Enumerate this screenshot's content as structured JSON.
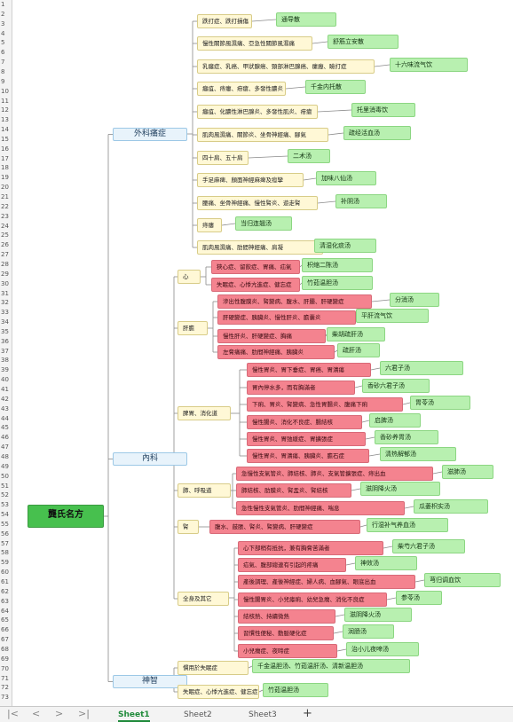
{
  "row_numbers": [
    "1",
    "2",
    "3",
    "4",
    "5",
    "6",
    "7",
    "8",
    "9",
    "10",
    "11",
    "12",
    "13",
    "14",
    "15",
    "16",
    "17",
    "18",
    "19",
    "20",
    "21",
    "22",
    "23",
    "24",
    "25",
    "26",
    "27",
    "28",
    "29",
    "30",
    "31",
    "32",
    "33",
    "34",
    "35",
    "36",
    "37",
    "38",
    "39",
    "40",
    "41",
    "42",
    "43",
    "44",
    "45",
    "46",
    "47",
    "48",
    "49",
    "50",
    "51",
    "52",
    "53",
    "54",
    "55",
    "56",
    "57",
    "58",
    "59",
    "60",
    "61",
    "62",
    "63",
    "64",
    "65",
    "66",
    "67",
    "68",
    "69",
    "70",
    "71",
    "72",
    "73"
  ],
  "mindmap": {
    "root": "龔氏名方",
    "categories": [
      "外科痛症",
      "內科",
      "神智"
    ],
    "subcats": [
      "心",
      "肝膽",
      "脾胃、消化道",
      "肺、呼吸道",
      "腎",
      "全身及其它"
    ],
    "surgery": [
      {
        "ill": "跌打症、跌打損傷",
        "rem": "通导散"
      },
      {
        "ill": "慢性關節風濕痛、亞急性關節風濕痛",
        "rem": "舒筋立安散"
      },
      {
        "ill": "乳癰症、乳癌、甲狀腺癌、頸部淋巴腺癌、瘰癧、瞼打症",
        "rem": "十六味流气饮"
      },
      {
        "ill": "癰疽、痔瘻、疳瘡、多發性膿炎",
        "rem": "千金内托散"
      },
      {
        "ill": "癰疽、化膿性淋巴腺炎、多發性肌炎、疳瘡",
        "rem": "托里消毒饮"
      },
      {
        "ill": "肌肉風濕痛、關節炎、坐骨神經痛、腳氣",
        "rem": "疏经活血汤"
      },
      {
        "ill": "四十肩、五十肩",
        "rem": "二术汤"
      },
      {
        "ill": "手足麻痺、顏面神經麻痺及痙攣",
        "rem": "加味八仙汤"
      },
      {
        "ill": "腰痛、坐骨神經痛、慢性腎炎、遊走腎",
        "rem": "补阴汤"
      },
      {
        "ill": "痔瘻",
        "rem": "当归连翘汤"
      },
      {
        "ill": "肌肉風濕痛、肋間神經痛、肩凝",
        "rem": "清湿化痰汤"
      }
    ],
    "heart": [
      {
        "ill": "狹心症、留飲症、胃痛、疝氣",
        "rem": "枳缩二陈汤"
      },
      {
        "ill": "失眠症、心悸亢進症、健忘症",
        "rem": "竹茹温胆汤"
      }
    ],
    "liver": [
      {
        "ill": "滲出性腹膜炎、腎變病、腹水、肝腫、肝硬變症",
        "rem": "分消汤"
      },
      {
        "ill": "肝硬變症、胰臟炎、慢性肝炎、膽囊炎",
        "rem": "平肝流气饮"
      },
      {
        "ill": "慢性肝炎、肝硬變症、胸痛",
        "rem": "柴胡疏肝汤"
      },
      {
        "ill": "左脅痛痛、肋間神經痛、胰臟炎",
        "rem": "疏肝汤"
      }
    ],
    "spleen": [
      {
        "ill": "慢性胃炎、胃下垂症、胃癌、胃潰瘍",
        "rem": "六君子汤"
      },
      {
        "ill": "胃內停水多，而有胸滿者",
        "rem": "香砂六君子汤"
      },
      {
        "ill": "下痢、胃炎、腎變病、急性胃腸炎、腹痛下痢",
        "rem": "胃苓汤"
      },
      {
        "ill": "慢性腸炎、消化不良症、腸結核",
        "rem": "启脾汤"
      },
      {
        "ill": "慢性胃炎、胃弛緩症、胃擴張症",
        "rem": "香砂养胃汤"
      },
      {
        "ill": "慢性胃炎、胃潰瘍、胰臟炎、膽石症",
        "rem": "清热解郁汤"
      }
    ],
    "lung": [
      {
        "ill": "急慢性支氣管炎、肺結核、肺炎、支氣管擴張症、痔出血",
        "rem": "滋肺汤"
      },
      {
        "ill": "肺結核、肋膜炎、腎盂炎、腎結核",
        "rem": "滋阴降火汤"
      },
      {
        "ill": "急性慢性支氣管炎、肋間神經痛、喘息",
        "rem": "瓜蒌枳实汤"
      }
    ],
    "kidney": [
      {
        "ill": "腹水、鼓脹、腎炎、腎變病、肝硬變症",
        "rem": "行湿补气养血汤"
      }
    ],
    "other": [
      {
        "ill": "心下部稍有抵抗，兼有胸脅苦滿者",
        "rem": "柴芍六君子汤"
      },
      {
        "ill": "疝氣、腹部總連有引起的疼痛",
        "rem": "神效汤"
      },
      {
        "ill": "產後調理、產後神經症、婦人病、血腳氣、眼底出血",
        "rem": "芎归调血饮"
      },
      {
        "ill": "慢性腸胃炎、小兒瘧痢、幼兒急癇、消化不良症",
        "rem": "参苓汤"
      },
      {
        "ill": "結核熱、持續微熱",
        "rem": "滋阴降火汤"
      },
      {
        "ill": "習慣性便秘、動脈硬化症",
        "rem": "润肠汤"
      },
      {
        "ill": "小兒癇症、夜啼症",
        "rem": "治小儿夜啼汤"
      }
    ],
    "mind": [
      {
        "ill": "慣用於失眠症",
        "rem": "千金温胆汤、竹茹温肝汤、清新温胆汤"
      },
      {
        "ill": "失眠症、心悸亢進症、健忘症",
        "rem": "竹茹温胆汤"
      }
    ]
  },
  "sheet_tabs": [
    "Sheet1",
    "Sheet2",
    "Sheet3"
  ],
  "add_tab": "+",
  "nav_buttons": [
    "|<",
    "<",
    ">",
    ">|"
  ]
}
